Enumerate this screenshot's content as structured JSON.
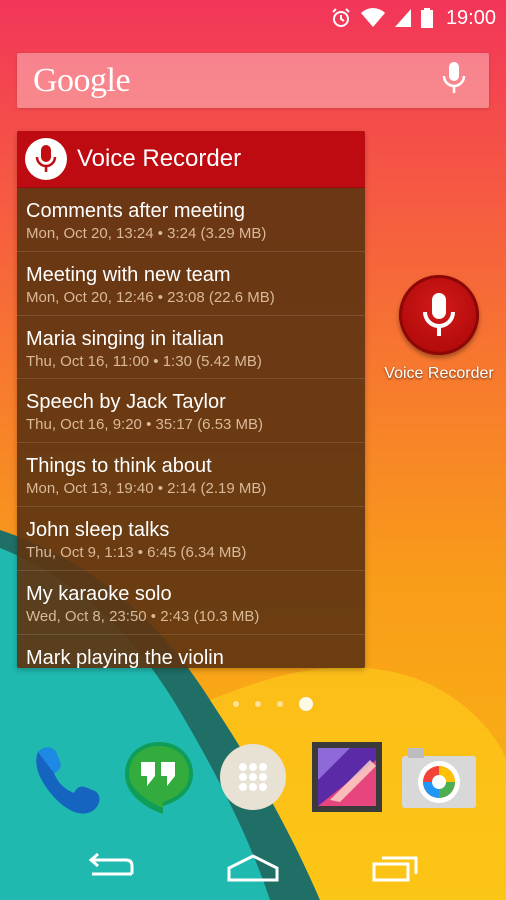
{
  "status_bar": {
    "time": "19:00",
    "icons": [
      "alarm-icon",
      "wifi-icon",
      "signal-icon",
      "battery-icon"
    ]
  },
  "search": {
    "logo_text": "Google",
    "icon": "mic-icon"
  },
  "widget": {
    "title": "Voice Recorder",
    "icon": "mic-icon",
    "recordings": [
      {
        "title": "Comments after meeting",
        "meta": "Mon, Oct 20, 13:24 • 3:24 (3.29 MB)"
      },
      {
        "title": "Meeting with new team",
        "meta": "Mon, Oct 20, 12:46 • 23:08 (22.6 MB)"
      },
      {
        "title": "Maria singing in italian",
        "meta": "Thu, Oct 16, 11:00 • 1:30 (5.42 MB)"
      },
      {
        "title": "Speech by Jack Taylor",
        "meta": "Thu, Oct 16, 9:20 • 35:17 (6.53 MB)"
      },
      {
        "title": "Things to think about",
        "meta": "Mon, Oct 13, 19:40 • 2:14 (2.19 MB)"
      },
      {
        "title": "John sleep talks",
        "meta": "Thu, Oct 9, 1:13 • 6:45 (6.34 MB)"
      },
      {
        "title": "My karaoke solo",
        "meta": "Wed, Oct 8, 23:50 • 2:43 (10.3 MB)"
      },
      {
        "title": "Mark playing the violin",
        "meta": ""
      }
    ]
  },
  "desktop_shortcut": {
    "label": "Voice Recorder",
    "icon": "mic-icon"
  },
  "home_pages": {
    "count": 4,
    "active": 4
  },
  "dock": [
    {
      "name": "phone",
      "icon": "phone-icon"
    },
    {
      "name": "hangouts",
      "icon": "hangouts-icon"
    },
    {
      "name": "app-drawer",
      "icon": "apps-grid-icon"
    },
    {
      "name": "gallery",
      "icon": "gallery-icon"
    },
    {
      "name": "camera",
      "icon": "camera-icon"
    }
  ],
  "nav_bar": [
    "back-icon",
    "home-icon",
    "recents-icon"
  ],
  "colors": {
    "widget_header": "#be0b12",
    "widget_body": "#5e3411",
    "accent_red": "#c20d12"
  }
}
